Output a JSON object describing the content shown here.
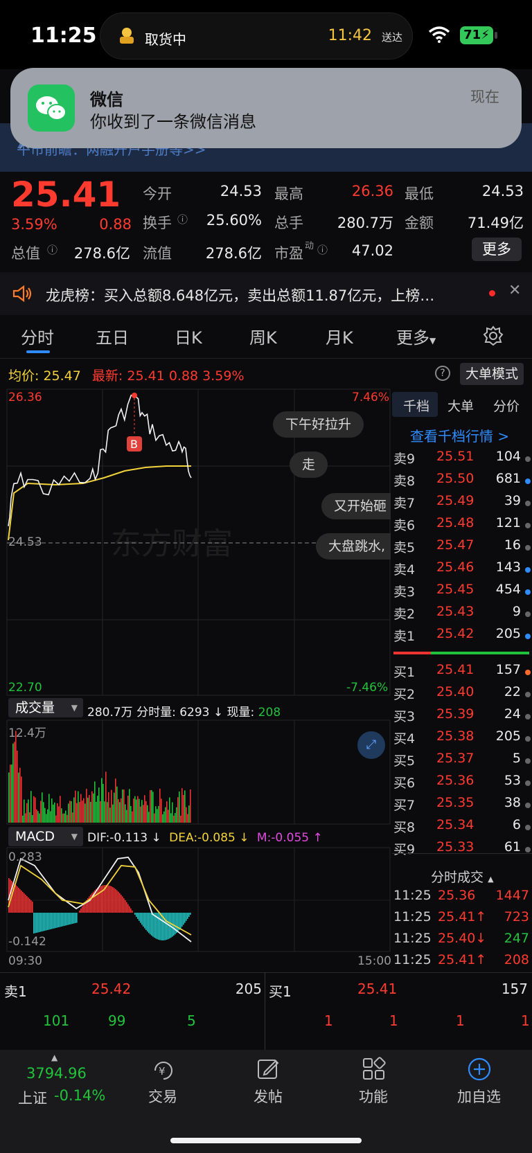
{
  "status_bar": {
    "time": "11:25",
    "island_label": "取货中",
    "island_time": "11:42",
    "island_suffix": "送达",
    "battery": "71"
  },
  "notification": {
    "app": "微信",
    "message": "你收到了一条微信消息",
    "when": "现在",
    "underlying_banner": "午市前瞻：两融开户手册等>>"
  },
  "quote": {
    "price": "25.41",
    "change_pct": "3.59%",
    "change": "0.88",
    "fields": [
      {
        "label": "今开",
        "value": "24.53",
        "color": "white"
      },
      {
        "label": "最高",
        "value": "26.36",
        "color": "red"
      },
      {
        "label": "最低",
        "value": "24.53",
        "color": "white"
      },
      {
        "label": "换手",
        "value": "25.60%",
        "color": "white"
      },
      {
        "label": "总手",
        "value": "280.7万",
        "color": "white"
      },
      {
        "label": "金额",
        "value": "71.49亿",
        "color": "white"
      },
      {
        "label": "总值",
        "value": "278.6亿",
        "color": "white"
      },
      {
        "label": "流值",
        "value": "278.6亿",
        "color": "white"
      },
      {
        "label": "市盈",
        "sup": "动",
        "value": "47.02",
        "color": "white"
      }
    ],
    "more_button": "更多"
  },
  "dragon_tiger": {
    "text": "龙虎榜：买入总额8.648亿元，卖出总额11.87亿元，上榜…"
  },
  "tabs": [
    "分时",
    "五日",
    "日K",
    "周K",
    "月K",
    "更多"
  ],
  "info_line": {
    "avg_label": "均价:",
    "avg_value": "25.47",
    "last_label": "最新:",
    "last_value": "25.41",
    "change": "0.88",
    "change_pct": "3.59%",
    "big_order_button": "大单模式"
  },
  "chart_axes": {
    "high": "26.36",
    "low": "22.70",
    "high_pct": "7.46%",
    "low_pct": "-7.46%",
    "ref": "24.53",
    "marker": "B",
    "watermark": "东方财富",
    "start_time": "09:30",
    "end_time": "15:00"
  },
  "comments": [
    "下午好拉升",
    "走",
    "又开始砸",
    "大盘跳水,"
  ],
  "volume_panel": {
    "selector": "成交量",
    "total": "280.7万",
    "minute_vol_label": "分时量:",
    "minute_vol": "6293",
    "cur_vol_label": "现量:",
    "cur_vol": "208",
    "max_label": "12.4万"
  },
  "macd_panel": {
    "selector": "MACD",
    "dif": "DIF:-0.113 ↓",
    "dea": "DEA:-0.085 ↓",
    "m": "M:-0.055 ↑",
    "top": "0.283",
    "bottom": "-0.142"
  },
  "order_book": {
    "tabs": [
      "千档",
      "大单",
      "分价"
    ],
    "link": "查看千档行情 >",
    "asks": [
      {
        "label": "卖9",
        "price": "25.51",
        "vol": "104",
        "dot": "#666"
      },
      {
        "label": "卖8",
        "price": "25.50",
        "vol": "681",
        "dot": "#2f8cff"
      },
      {
        "label": "卖7",
        "price": "25.49",
        "vol": "39",
        "dot": "#666"
      },
      {
        "label": "卖6",
        "price": "25.48",
        "vol": "121",
        "dot": "#666"
      },
      {
        "label": "卖5",
        "price": "25.47",
        "vol": "16",
        "dot": "#666"
      },
      {
        "label": "卖4",
        "price": "25.46",
        "vol": "143",
        "dot": "#2f8cff"
      },
      {
        "label": "卖3",
        "price": "25.45",
        "vol": "454",
        "dot": "#2f8cff"
      },
      {
        "label": "卖2",
        "price": "25.43",
        "vol": "9",
        "dot": "#666"
      },
      {
        "label": "卖1",
        "price": "25.42",
        "vol": "205",
        "dot": "#2f8cff"
      }
    ],
    "bids": [
      {
        "label": "买1",
        "price": "25.41",
        "vol": "157",
        "dot": "#ff6a2a"
      },
      {
        "label": "买2",
        "price": "25.40",
        "vol": "22",
        "dot": "#666"
      },
      {
        "label": "买3",
        "price": "25.39",
        "vol": "24",
        "dot": "#666"
      },
      {
        "label": "买4",
        "price": "25.38",
        "vol": "205",
        "dot": "#666"
      },
      {
        "label": "买5",
        "price": "25.37",
        "vol": "5",
        "dot": "#666"
      },
      {
        "label": "买6",
        "price": "25.36",
        "vol": "53",
        "dot": "#666"
      },
      {
        "label": "买7",
        "price": "25.35",
        "vol": "38",
        "dot": "#666"
      },
      {
        "label": "买8",
        "price": "25.34",
        "vol": "6",
        "dot": "#666"
      },
      {
        "label": "买9",
        "price": "25.33",
        "vol": "61",
        "dot": "#666"
      }
    ],
    "trades_header": "分时成交",
    "trades": [
      {
        "time": "11:25",
        "price": "25.36",
        "vol": "1447",
        "vol_color": "#ff3b30"
      },
      {
        "time": "11:25",
        "price": "25.41↑",
        "vol": "723",
        "vol_color": "#ff3b30"
      },
      {
        "time": "11:25",
        "price": "25.40↓",
        "vol": "247",
        "vol_color": "#22c33c"
      },
      {
        "time": "11:25",
        "price": "25.41↑",
        "vol": "208",
        "vol_color": "#ff3b30"
      }
    ]
  },
  "level1": {
    "sell_label": "卖1",
    "sell_price": "25.42",
    "sell_vol": "205",
    "buy_label": "买1",
    "buy_price": "25.41",
    "buy_vol": "157",
    "sell_queue": [
      "101",
      "99",
      "5"
    ],
    "buy_queue": [
      "1",
      "1",
      "1",
      "1"
    ]
  },
  "bottom_nav": {
    "index_value": "3794.96",
    "index_name": "上证",
    "index_change": "-0.14%",
    "items": [
      "交易",
      "发帖",
      "功能",
      "加自选"
    ]
  }
}
